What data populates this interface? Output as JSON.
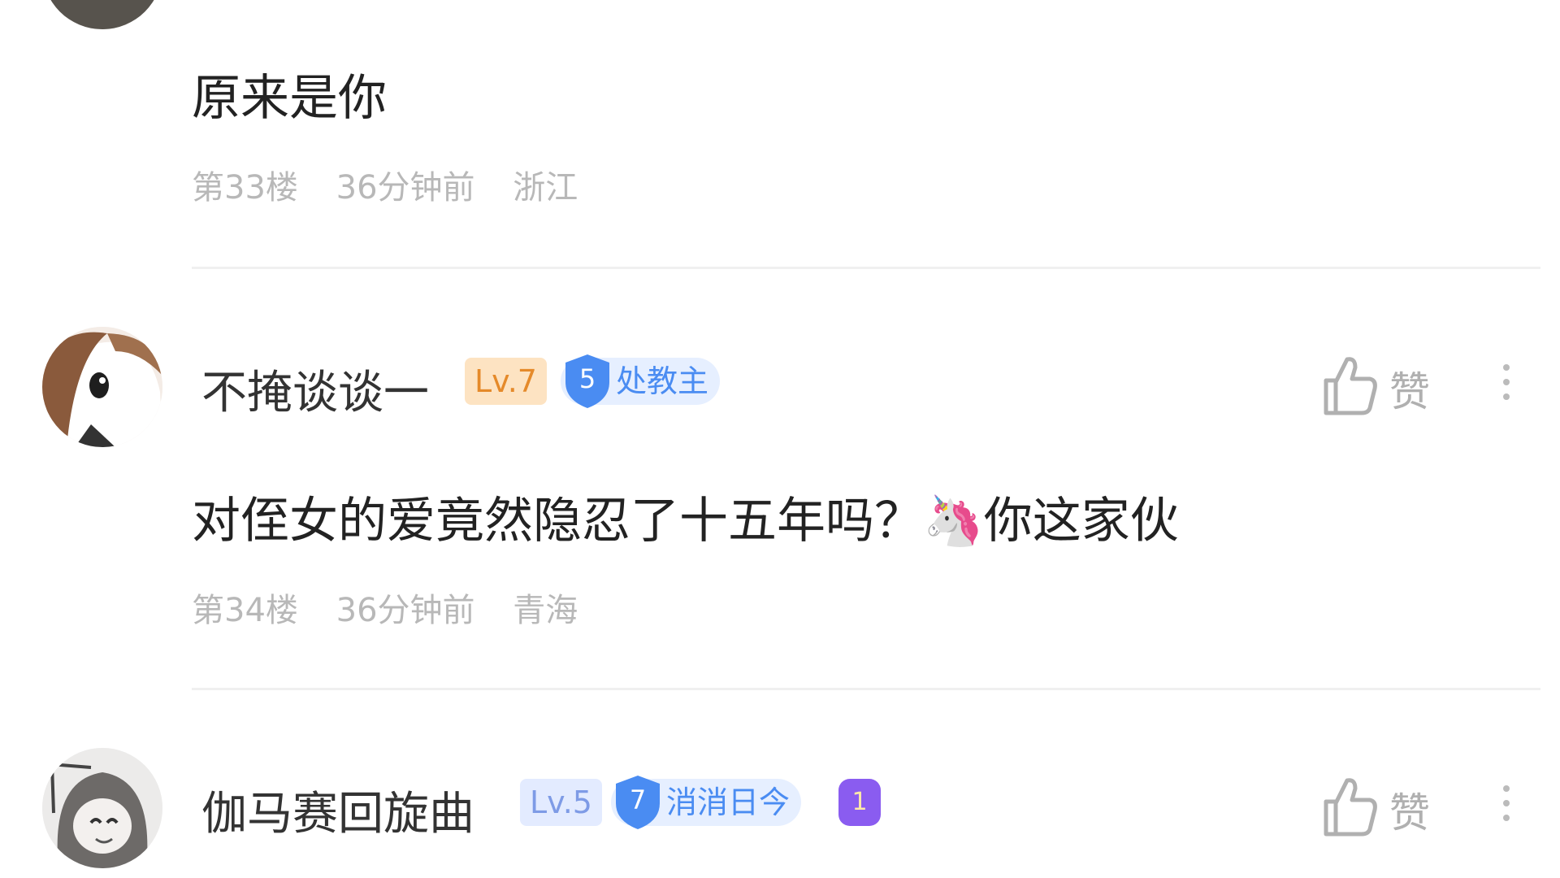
{
  "comments": [
    {
      "username": "",
      "content": "原来是你",
      "floor": "第33楼",
      "time": "36分钟前",
      "location": "浙江"
    },
    {
      "username": "不掩谈谈一",
      "level": "Lv.7",
      "badge_number": "5",
      "badge_title": "处教主",
      "content": "对侄女的爱竟然隐忍了十五年吗？🦄你这家伙",
      "floor": "第34楼",
      "time": "36分钟前",
      "location": "青海",
      "like_label": "赞"
    },
    {
      "username": "伽马赛回旋曲",
      "level": "Lv.5",
      "badge_number": "7",
      "badge_title": "消消日今",
      "extra_badge": "1",
      "like_label": "赞"
    }
  ],
  "colors": {
    "text": "#222222",
    "meta": "#b8b8b8",
    "badge_blue": "#4a8cf2",
    "level_orange": "#e58a2a",
    "level_blue": "#7e9be6",
    "extra_badge": "#8a5cf0"
  },
  "icons": [
    "thumbs-up-icon",
    "more-vertical-icon",
    "shield-badge-icon"
  ]
}
